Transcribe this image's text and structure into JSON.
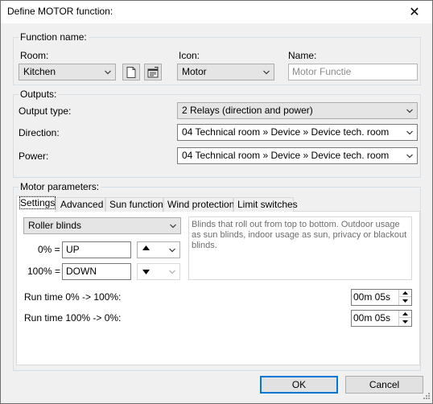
{
  "window": {
    "title": "Define MOTOR function:",
    "close_glyph": "✕"
  },
  "function_name": {
    "legend": "Function name:",
    "room_label": "Room:",
    "room_value": "Kitchen",
    "icon_label": "Icon:",
    "icon_value": "Motor",
    "name_label": "Name:",
    "name_placeholder": "Motor Functie"
  },
  "outputs": {
    "legend": "Outputs:",
    "type_label": "Output type:",
    "type_value": "2 Relays (direction and power)",
    "direction_label": "Direction:",
    "direction_value": "04  Technical room » Device » Device tech. room",
    "power_label": "Power:",
    "power_value": "04  Technical room » Device » Device tech. room"
  },
  "motor": {
    "legend": "Motor parameters:",
    "tabs": [
      {
        "label": "Settings",
        "active": true
      },
      {
        "label": "Advanced",
        "active": false
      },
      {
        "label": "Sun function",
        "active": false
      },
      {
        "label": "Wind protection",
        "active": false
      },
      {
        "label": "Limit switches",
        "active": false
      }
    ],
    "blind_type": "Roller blinds",
    "description": "Blinds that roll out from top to bottom. Outdoor usage as sun blinds, indoor usage as sun, privacy or blackout blinds.",
    "pos0_label": "0% =",
    "pos0_value": "UP",
    "pos100_label": "100% =",
    "pos100_value": "DOWN",
    "run_up_label": "Run time 0% -> 100%:",
    "run_up_value": "00m 05s",
    "run_down_label": "Run time 100% -> 0%:",
    "run_down_value": "00m 05s"
  },
  "buttons": {
    "ok": "OK",
    "cancel": "Cancel"
  },
  "colors": {
    "accent": "#0078d7",
    "border": "#acacac",
    "panel": "#ffffff"
  }
}
